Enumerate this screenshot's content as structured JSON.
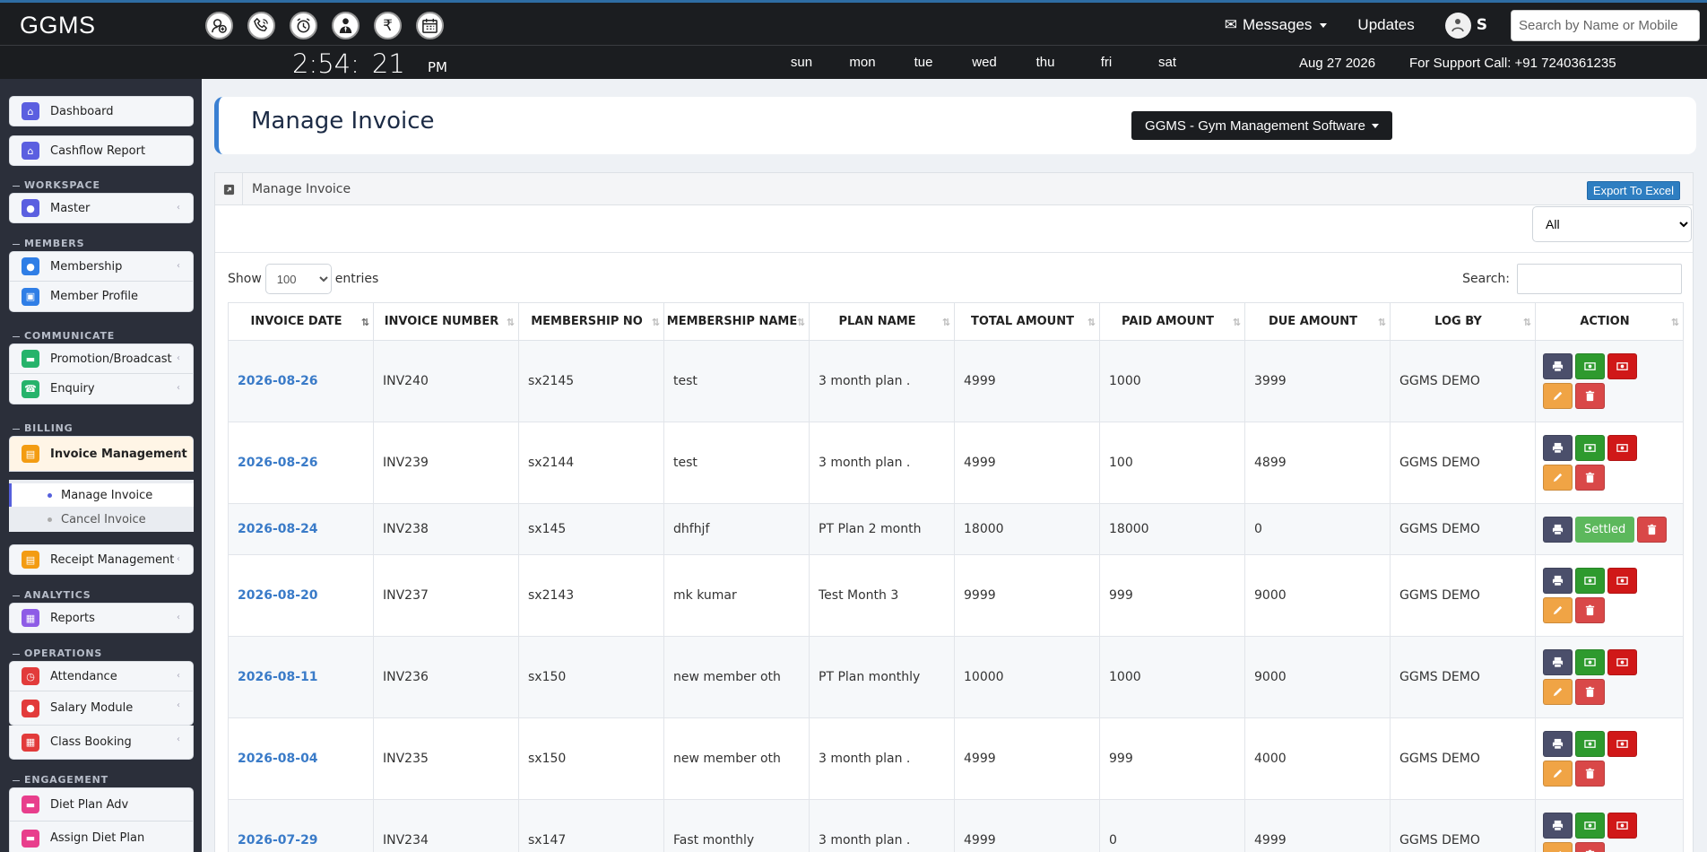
{
  "brand": "GGMS",
  "quick_icons": [
    "add-member-icon",
    "phone-icon",
    "alarm-clock-icon",
    "user-tie-icon",
    "rupee-icon",
    "calendar-icon"
  ],
  "nav": {
    "messages": "Messages",
    "updates": "Updates",
    "user_initial": "S",
    "search_placeholder": "Search by Name or Mobile"
  },
  "clock": {
    "time": "2:54:",
    "seconds": "21",
    "ampm": "PM",
    "days": [
      "sun",
      "mon",
      "tue",
      "wed",
      "thu",
      "fri",
      "sat"
    ],
    "date": "Aug 27 2026",
    "support": "For Support Call: +91 7240361235"
  },
  "sidebar": {
    "dashboard": "Dashboard",
    "cashflow": "Cashflow Report",
    "h_workspace": "WORKSPACE",
    "master": "Master",
    "h_members": "MEMBERS",
    "membership": "Membership",
    "member_profile": "Member Profile",
    "h_communicate": "COMMUNICATE",
    "promotion": "Promotion/Broadcast",
    "enquiry": "Enquiry",
    "h_billing": "BILLING",
    "invoice_mgmt": "Invoice Management",
    "manage_invoice": "Manage Invoice",
    "cancel_invoice": "Cancel Invoice",
    "receipt_mgmt": "Receipt Management",
    "h_analytics": "ANALYTICS",
    "reports": "Reports",
    "h_operations": "OPERATIONS",
    "attendance": "Attendance",
    "salary": "Salary Module",
    "class_booking": "Class Booking",
    "h_engagement": "ENGAGEMENT",
    "diet_plan_adv": "Diet Plan Adv",
    "assign_diet": "Assign Diet Plan"
  },
  "page": {
    "title": "Manage Invoice",
    "software_button": "GGMS - Gym Management Software",
    "panel_title": "Manage Invoice",
    "export": "Export To Excel",
    "filter_value": "All",
    "show_label": "Show",
    "show_value": "100",
    "entries_label": "entries",
    "search_label": "Search:"
  },
  "table": {
    "headers": [
      "INVOICE DATE",
      "INVOICE NUMBER",
      "MEMBERSHIP NO",
      "MEMBERSHIP NAME",
      "PLAN NAME",
      "TOTAL AMOUNT",
      "PAID AMOUNT",
      "DUE AMOUNT",
      "LOG BY",
      "ACTION"
    ],
    "rows": [
      {
        "date": "2026-08-26",
        "invoice": "INV240",
        "mno": "sx2145",
        "mname": "test",
        "plan": "3 month plan .",
        "total": "4999",
        "paid": "1000",
        "due": "3999",
        "logby": "GGMS DEMO",
        "settled": false
      },
      {
        "date": "2026-08-26",
        "invoice": "INV239",
        "mno": "sx2144",
        "mname": "test",
        "plan": "3 month plan .",
        "total": "4999",
        "paid": "100",
        "due": "4899",
        "logby": "GGMS DEMO",
        "settled": false
      },
      {
        "date": "2026-08-24",
        "invoice": "INV238",
        "mno": "sx145",
        "mname": "dhfhjf",
        "plan": "PT Plan 2 month",
        "total": "18000",
        "paid": "18000",
        "due": "0",
        "logby": "GGMS DEMO",
        "settled": true,
        "settled_label": "Settled"
      },
      {
        "date": "2026-08-20",
        "invoice": "INV237",
        "mno": "sx2143",
        "mname": "mk kumar",
        "plan": "Test Month 3",
        "total": "9999",
        "paid": "999",
        "due": "9000",
        "logby": "GGMS DEMO",
        "settled": false
      },
      {
        "date": "2026-08-11",
        "invoice": "INV236",
        "mno": "sx150",
        "mname": "new member oth",
        "plan": "PT Plan monthly",
        "total": "10000",
        "paid": "1000",
        "due": "9000",
        "logby": "GGMS DEMO",
        "settled": false
      },
      {
        "date": "2026-08-04",
        "invoice": "INV235",
        "mno": "sx150",
        "mname": "new member oth",
        "plan": "3 month plan .",
        "total": "4999",
        "paid": "999",
        "due": "4000",
        "logby": "GGMS DEMO",
        "settled": false
      },
      {
        "date": "2026-07-29",
        "invoice": "INV234",
        "mno": "sx147",
        "mname": "Fast monthly",
        "plan": "3 month plan .",
        "total": "4999",
        "paid": "0",
        "due": "4999",
        "logby": "GGMS DEMO",
        "settled": false
      }
    ]
  },
  "colors": {
    "accent": "#3a80d2",
    "topbar": "#1b1d20",
    "sidebar": "#2b2f3a"
  }
}
